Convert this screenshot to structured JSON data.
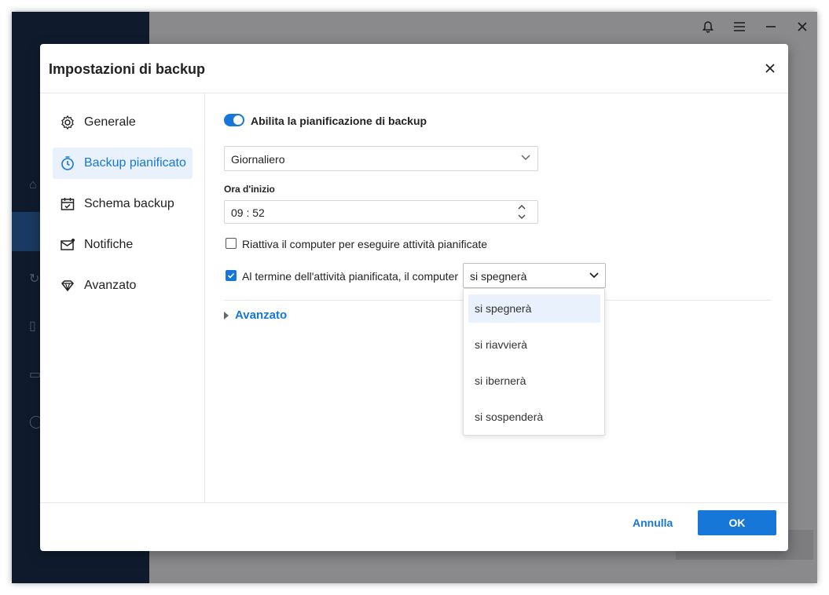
{
  "dialog": {
    "title": "Impostazioni di backup"
  },
  "nav": {
    "items": [
      {
        "label": "Generale",
        "icon": "gear-icon"
      },
      {
        "label": "Backup pianificato",
        "icon": "timer-icon",
        "active": true
      },
      {
        "label": "Schema backup",
        "icon": "calendar-icon"
      },
      {
        "label": "Notifiche",
        "icon": "mail-icon"
      },
      {
        "label": "Avanzato",
        "icon": "diamond-icon"
      }
    ]
  },
  "schedule": {
    "enable_label": "Abilita la pianificazione di backup",
    "enabled": true,
    "frequency": "Giornaliero",
    "start_time_label": "Ora d'inizio",
    "start_time": "09 : 52",
    "wake_label": "Riattiva il computer per eseguire attività pianificate",
    "wake_checked": false,
    "after_label": "Al termine dell'attività pianificata, il computer",
    "after_checked": true,
    "after_action": "si spegnerà",
    "after_options": [
      "si spegnerà",
      "si riavvierà",
      "si ibernerà",
      "si sospenderà"
    ],
    "advanced_label": "Avanzato"
  },
  "footer": {
    "cancel_label": "Annulla",
    "ok_label": "OK"
  },
  "colors": {
    "accent": "#1677d9",
    "sidebar_bg": "#0f1b2d"
  }
}
